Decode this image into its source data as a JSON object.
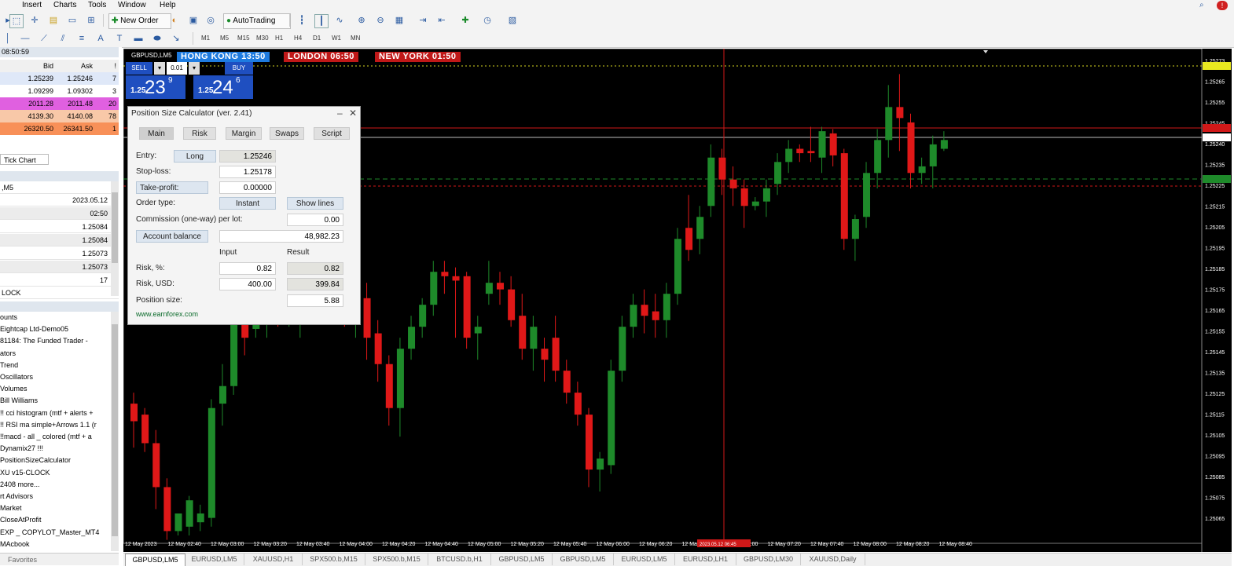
{
  "menu": [
    "Insert",
    "Charts",
    "Tools",
    "Window",
    "Help"
  ],
  "toolbar": {
    "new_order": "New Order",
    "autotrading": "AutoTrading",
    "timeframes": [
      "M1",
      "M5",
      "M15",
      "M30",
      "H1",
      "H4",
      "D1",
      "W1",
      "MN"
    ]
  },
  "market_watch": {
    "time": "08:50:59",
    "col_bid": "Bid",
    "col_ask": "Ask",
    "col_spread": "!",
    "rows": [
      {
        "bid": "1.25239",
        "ask": "1.25246",
        "spread": "7",
        "color": "#dfe8f8"
      },
      {
        "bid": "1.09299",
        "ask": "1.09302",
        "spread": "3",
        "color": "#ffffff"
      },
      {
        "bid": "2011.28",
        "ask": "2011.48",
        "spread": "20",
        "color": "#e060e0"
      },
      {
        "bid": "4139.30",
        "ask": "4140.08",
        "spread": "78",
        "color": "#f8c8a8"
      },
      {
        "bid": "26320.50",
        "ask": "26341.50",
        "spread": "1",
        "color": "#f89058"
      }
    ],
    "tab": "Tick Chart"
  },
  "data_window": {
    "symbol": ",M5",
    "values": [
      "2023.05.12",
      "02:50",
      "1.25084",
      "1.25084",
      "1.25073",
      "1.25073",
      "17"
    ],
    "footer": "LOCK"
  },
  "navigator": {
    "items": [
      "ounts",
      "Eightcap Ltd-Demo05",
      "81184: The Funded Trader -",
      "ators",
      "Trend",
      "Oscillators",
      "Volumes",
      "Bill Williams",
      "!! cci histogram (mtf + alerts +",
      "!! RSI ma simple+Arrows 1.1 (r",
      "!!macd - all _ colored (mtf + a",
      "Dynamix27 !!!",
      "PositionSizeCalculator",
      "XU v15-CLOCK",
      "2408 more...",
      "rt Advisors",
      "Market",
      "CloseAtProfit",
      "EXP _ COPYLOT_Master_MT4",
      "MAcbook"
    ],
    "favorites": "Favorites"
  },
  "chart": {
    "symbol_tab": "GBPUSD,LM5",
    "clocks": [
      {
        "label": "HONG KONG 13:50",
        "color": "#1e7be0"
      },
      {
        "label": "LONDON 06:50",
        "color": "#c01818"
      },
      {
        "label": "NEW YORK 01:50",
        "color": "#c01818"
      }
    ],
    "one_click": {
      "sell": "SELL",
      "buy": "BUY",
      "lot": "0.01",
      "sell_small": "1.25",
      "sell_big": "23",
      "sell_sup": "9",
      "buy_small": "1.25",
      "buy_big": "24",
      "buy_sup": "6"
    },
    "price_labels": [
      "1.25273",
      "1.25265",
      "1.25255",
      "1.25245",
      "1.25240",
      "1.25235",
      "1.25225",
      "1.25215",
      "1.25205",
      "1.25195",
      "1.25185",
      "1.25175",
      "1.25165",
      "1.25155",
      "1.25145",
      "1.25135",
      "1.25125",
      "1.25115",
      "1.25105",
      "1.25095",
      "1.25085",
      "1.25075",
      "1.25065"
    ],
    "time_labels": [
      "12 May 2023",
      "12 May 02:40",
      "12 May 03:00",
      "12 May 03:20",
      "12 May 03:40",
      "12 May 04:00",
      "12 May 04:20",
      "12 May 04:40",
      "12 May 05:00",
      "12 May 05:20",
      "12 May 05:40",
      "12 May 06:00",
      "12 May 06:20",
      "12 May 06:40",
      "12 May 07:00",
      "12 May 07:20",
      "12 May 07:40",
      "12 May 08:00",
      "12 May 08:20",
      "12 May 08:40"
    ],
    "crosshair_time": "2023.05.12 06:45",
    "candles": [
      {
        "o": 1.2512,
        "h": 1.25125,
        "c": 1.25112,
        "l": 1.251
      },
      {
        "o": 1.25115,
        "h": 1.25118,
        "c": 1.25102,
        "l": 1.25098
      },
      {
        "o": 1.25102,
        "h": 1.25108,
        "c": 1.25082,
        "l": 1.25072
      },
      {
        "o": 1.25082,
        "h": 1.25086,
        "c": 1.25062,
        "l": 1.25058
      },
      {
        "o": 1.25062,
        "h": 1.2507,
        "c": 1.2507,
        "l": 1.2506
      },
      {
        "o": 1.25064,
        "h": 1.25078,
        "c": 1.25076,
        "l": 1.2506
      },
      {
        "o": 1.25066,
        "h": 1.25074,
        "c": 1.2507,
        "l": 1.25062
      },
      {
        "o": 1.25068,
        "h": 1.25122,
        "c": 1.25118,
        "l": 1.25064
      },
      {
        "o": 1.2512,
        "h": 1.25138,
        "c": 1.25128,
        "l": 1.2511
      },
      {
        "o": 1.25128,
        "h": 1.25165,
        "c": 1.25158,
        "l": 1.25124
      },
      {
        "o": 1.2516,
        "h": 1.25172,
        "c": 1.2515,
        "l": 1.25142
      },
      {
        "o": 1.25154,
        "h": 1.25168,
        "c": 1.25165,
        "l": 1.2515
      },
      {
        "o": 1.2516,
        "h": 1.2517,
        "c": 1.25162,
        "l": 1.2515
      },
      {
        "o": 1.25162,
        "h": 1.2517,
        "c": 1.2516,
        "l": 1.25155
      },
      {
        "o": 1.25162,
        "h": 1.2517,
        "c": 1.25165,
        "l": 1.25155
      },
      {
        "o": 1.2516,
        "h": 1.2518,
        "c": 1.2517,
        "l": 1.2515
      },
      {
        "o": 1.2517,
        "h": 1.25178,
        "c": 1.25165,
        "l": 1.2516
      },
      {
        "o": 1.25165,
        "h": 1.25175,
        "c": 1.25162,
        "l": 1.25158
      },
      {
        "o": 1.25168,
        "h": 1.2518,
        "c": 1.25166,
        "l": 1.2516
      },
      {
        "o": 1.25165,
        "h": 1.25172,
        "c": 1.2516,
        "l": 1.25155
      },
      {
        "o": 1.2516,
        "h": 1.25178,
        "c": 1.2517,
        "l": 1.2515
      },
      {
        "o": 1.25168,
        "h": 1.25175,
        "c": 1.2515,
        "l": 1.2514
      },
      {
        "o": 1.25152,
        "h": 1.25158,
        "c": 1.25138,
        "l": 1.2513
      },
      {
        "o": 1.25138,
        "h": 1.25142,
        "c": 1.25118,
        "l": 1.2511
      },
      {
        "o": 1.25118,
        "h": 1.2515,
        "c": 1.25145,
        "l": 1.25105
      },
      {
        "o": 1.25145,
        "h": 1.2516,
        "c": 1.25155,
        "l": 1.2514
      },
      {
        "o": 1.25155,
        "h": 1.25168,
        "c": 1.25165,
        "l": 1.2515
      },
      {
        "o": 1.25165,
        "h": 1.25185,
        "c": 1.2518,
        "l": 1.2516
      },
      {
        "o": 1.2518,
        "h": 1.25185,
        "c": 1.25178,
        "l": 1.2517
      },
      {
        "o": 1.25178,
        "h": 1.25182,
        "c": 1.25176,
        "l": 1.2515
      },
      {
        "o": 1.25178,
        "h": 1.2518,
        "c": 1.2515,
        "l": 1.25145
      },
      {
        "o": 1.25152,
        "h": 1.2516,
        "c": 1.25155,
        "l": 1.2514
      },
      {
        "o": 1.2517,
        "h": 1.25185,
        "c": 1.25175,
        "l": 1.25165
      },
      {
        "o": 1.25175,
        "h": 1.2518,
        "c": 1.25172,
        "l": 1.25165
      },
      {
        "o": 1.25172,
        "h": 1.25178,
        "c": 1.25158,
        "l": 1.25155
      },
      {
        "o": 1.2516,
        "h": 1.2517,
        "c": 1.25145,
        "l": 1.2514
      },
      {
        "o": 1.25145,
        "h": 1.2516,
        "c": 1.25155,
        "l": 1.25135
      },
      {
        "o": 1.25145,
        "h": 1.2515,
        "c": 1.2514,
        "l": 1.2513
      },
      {
        "o": 1.2515,
        "h": 1.2516,
        "c": 1.25135,
        "l": 1.2513
      },
      {
        "o": 1.25135,
        "h": 1.2514,
        "c": 1.25125,
        "l": 1.2512
      },
      {
        "o": 1.25125,
        "h": 1.2513,
        "c": 1.25115,
        "l": 1.2511
      },
      {
        "o": 1.25115,
        "h": 1.25118,
        "c": 1.2509,
        "l": 1.25082
      },
      {
        "o": 1.2509,
        "h": 1.25098,
        "c": 1.25095,
        "l": 1.2508
      },
      {
        "o": 1.25092,
        "h": 1.2514,
        "c": 1.25135,
        "l": 1.25088
      },
      {
        "o": 1.25135,
        "h": 1.2516,
        "c": 1.25155,
        "l": 1.2513
      },
      {
        "o": 1.25155,
        "h": 1.2517,
        "c": 1.25165,
        "l": 1.2515
      },
      {
        "o": 1.25165,
        "h": 1.25172,
        "c": 1.2516,
        "l": 1.25152
      },
      {
        "o": 1.25162,
        "h": 1.2517,
        "c": 1.25158,
        "l": 1.2515
      },
      {
        "o": 1.25158,
        "h": 1.25175,
        "c": 1.2517,
        "l": 1.2515
      },
      {
        "o": 1.2517,
        "h": 1.252,
        "c": 1.25195,
        "l": 1.25165
      },
      {
        "o": 1.252,
        "h": 1.25215,
        "c": 1.2519,
        "l": 1.25185
      },
      {
        "o": 1.25195,
        "h": 1.2521,
        "c": 1.25205,
        "l": 1.25188
      },
      {
        "o": 1.2521,
        "h": 1.25238,
        "c": 1.25232,
        "l": 1.25205
      },
      {
        "o": 1.25232,
        "h": 1.25236,
        "c": 1.25222,
        "l": 1.25215
      },
      {
        "o": 1.25222,
        "h": 1.25228,
        "c": 1.25218,
        "l": 1.2521
      },
      {
        "o": 1.25218,
        "h": 1.25222,
        "c": 1.2521,
        "l": 1.252
      },
      {
        "o": 1.2521,
        "h": 1.25214,
        "c": 1.25212,
        "l": 1.25208
      },
      {
        "o": 1.25212,
        "h": 1.25222,
        "c": 1.25218,
        "l": 1.25205
      },
      {
        "o": 1.2522,
        "h": 1.25234,
        "c": 1.2523,
        "l": 1.25215
      },
      {
        "o": 1.2523,
        "h": 1.2524,
        "c": 1.25236,
        "l": 1.25225
      },
      {
        "o": 1.25236,
        "h": 1.25238,
        "c": 1.25234,
        "l": 1.2523
      },
      {
        "o": 1.25235,
        "h": 1.25246,
        "c": 1.25234,
        "l": 1.2523
      },
      {
        "o": 1.25232,
        "h": 1.25246,
        "c": 1.25244,
        "l": 1.25225
      },
      {
        "o": 1.25243,
        "h": 1.25245,
        "c": 1.25233,
        "l": 1.25228
      },
      {
        "o": 1.25234,
        "h": 1.25236,
        "c": 1.25195,
        "l": 1.2519
      },
      {
        "o": 1.25195,
        "h": 1.25206,
        "c": 1.25204,
        "l": 1.25185
      },
      {
        "o": 1.25205,
        "h": 1.2523,
        "c": 1.25225,
        "l": 1.252
      },
      {
        "o": 1.25225,
        "h": 1.25245,
        "c": 1.2524,
        "l": 1.25218
      },
      {
        "o": 1.2524,
        "h": 1.25265,
        "c": 1.25255,
        "l": 1.25232
      },
      {
        "o": 1.25255,
        "h": 1.2527,
        "c": 1.2525,
        "l": 1.25235
      },
      {
        "o": 1.25248,
        "h": 1.25252,
        "c": 1.25225,
        "l": 1.25218
      },
      {
        "o": 1.25225,
        "h": 1.25232,
        "c": 1.25228,
        "l": 1.2522
      },
      {
        "o": 1.25228,
        "h": 1.25242,
        "c": 1.25238,
        "l": 1.25218
      },
      {
        "o": 1.25236,
        "h": 1.25244,
        "c": 1.2524,
        "l": 1.25235
      }
    ]
  },
  "psc": {
    "title": "Position Size Calculator (ver. 2.41)",
    "tabs": [
      "Main",
      "Risk",
      "Margin",
      "Swaps",
      "Script"
    ],
    "entry_label": "Entry:",
    "entry_dir": "Long",
    "entry_value": "1.25246",
    "sl_label": "Stop-loss:",
    "sl_value": "1.25178",
    "tp_label": "Take-profit:",
    "tp_value": "0.00000",
    "order_type_label": "Order type:",
    "order_type_value": "Instant",
    "show_lines": "Show lines",
    "commission_label": "Commission (one-way) per lot:",
    "commission_value": "0.00",
    "account_balance_label": "Account balance",
    "account_balance_value": "48,982.23",
    "col_input": "Input",
    "col_result": "Result",
    "risk_pct_label": "Risk, %:",
    "risk_pct_input": "0.82",
    "risk_pct_result": "0.82",
    "risk_usd_label": "Risk, USD:",
    "risk_usd_input": "400.00",
    "risk_usd_result": "399.84",
    "pos_size_label": "Position size:",
    "pos_size_value": "5.88",
    "link": "www.earnforex.com"
  },
  "bottom_tabs": [
    "GBPUSD,LM5",
    "EURUSD,LM5",
    "XAUUSD,H1",
    "SPX500.b,M15",
    "SPX500.b,M15",
    "BTCUSD.b,H1",
    "GBPUSD,LM5",
    "GBPUSD,LM5",
    "EURUSD,LM5",
    "EURUSD,LH1",
    "GBPUSD,LM30",
    "XAUUSD,Daily"
  ]
}
